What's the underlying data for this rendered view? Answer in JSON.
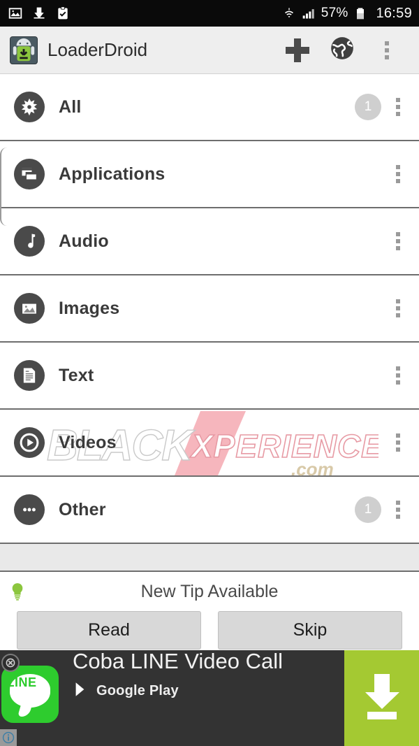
{
  "status_bar": {
    "left_icons": [
      "image-icon",
      "download-icon",
      "clipboard-task-icon"
    ],
    "wifi_icon": "wifi-icon",
    "signal_icon": "signal-bars-icon",
    "battery_percent": "57%",
    "battery_icon": "battery-icon",
    "time": "16:59"
  },
  "app_bar": {
    "logo": "loaderdroid-logo-icon",
    "title": "LoaderDroid",
    "actions": [
      {
        "name": "add-download-button",
        "icon": "plus-icon"
      },
      {
        "name": "browser-button",
        "icon": "globe-icon"
      },
      {
        "name": "overflow-menu-button",
        "icon": "overflow-dots-icon"
      }
    ]
  },
  "list": {
    "rows": [
      {
        "label": "All",
        "icon": "starburst-icon",
        "badge": "1"
      },
      {
        "label": "Applications",
        "icon": "windows-icon",
        "badge": ""
      },
      {
        "label": "Audio",
        "icon": "music-note-icon",
        "badge": ""
      },
      {
        "label": "Images",
        "icon": "photo-icon",
        "badge": ""
      },
      {
        "label": "Text",
        "icon": "document-icon",
        "badge": ""
      },
      {
        "label": "Videos",
        "icon": "play-circle-icon",
        "badge": ""
      },
      {
        "label": "Other",
        "icon": "ellipsis-icon",
        "badge": "1"
      }
    ]
  },
  "tip_bar": {
    "icon": "lightbulb-icon",
    "text": "New Tip Available",
    "read_label": "Read",
    "skip_label": "Skip",
    "bulb_color": "#8cc63e"
  },
  "ad": {
    "app_icon": "line-app-icon",
    "app_icon_word": "LINE",
    "title": "Coba LINE Video Call",
    "store_icon": "google-play-icon",
    "store_label": "Google Play",
    "cta_icon": "download-arrow-icon",
    "cta_color": "#a4c932",
    "close_icon": "close-icon",
    "info_icon": "info-icon"
  },
  "watermark": {
    "text_primary": "BLACK",
    "text_secondary": "XPERIENCE",
    "text_suffix": ".com"
  }
}
